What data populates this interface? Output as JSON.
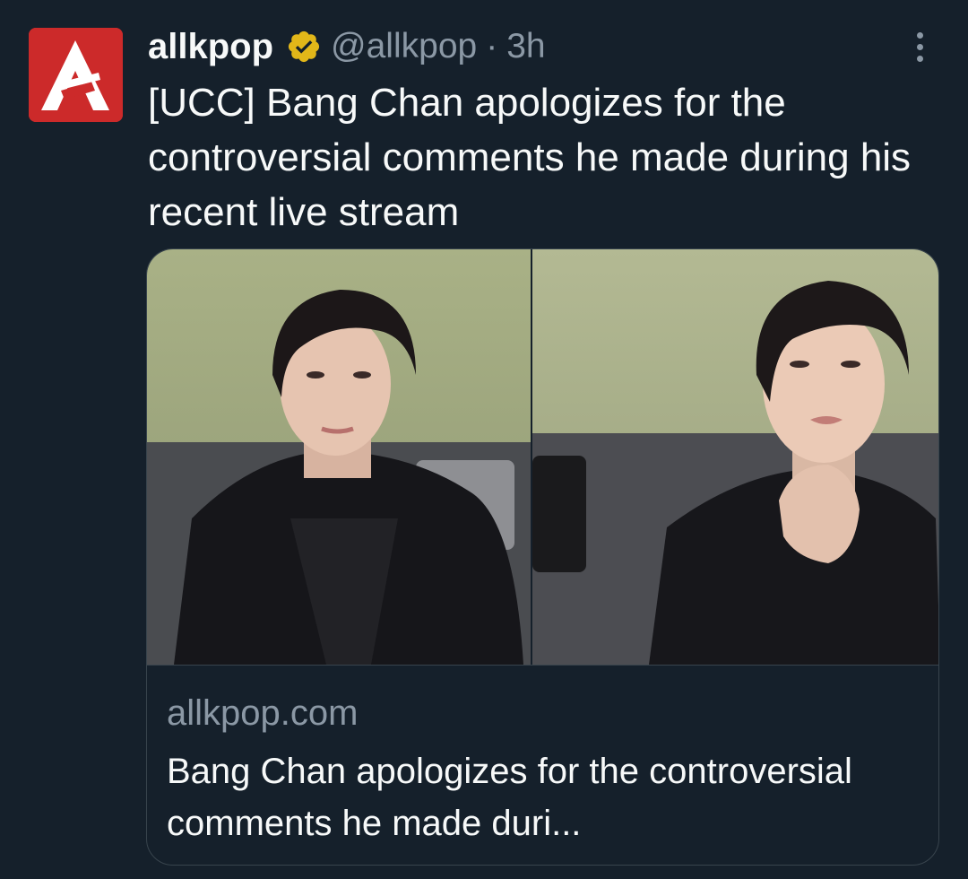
{
  "tweet": {
    "display_name": "allkpop",
    "handle": "@allkpop",
    "separator": "·",
    "time": "3h",
    "text": "[UCC] Bang Chan apologizes for the controversial comments he made during his recent live stream"
  },
  "card": {
    "domain": "allkpop.com",
    "title": "Bang Chan apologizes for the controversial comments he made duri..."
  },
  "icons": {
    "avatar": "allkpop-logo",
    "verified": "verified-badge-icon",
    "more": "more-options-icon"
  },
  "colors": {
    "background": "#15202b",
    "text_primary": "#f7f9f9",
    "text_secondary": "#8b98a5",
    "border": "#38444d",
    "avatar_red": "#cc2a2a",
    "verified_gold": "#e2b719"
  }
}
